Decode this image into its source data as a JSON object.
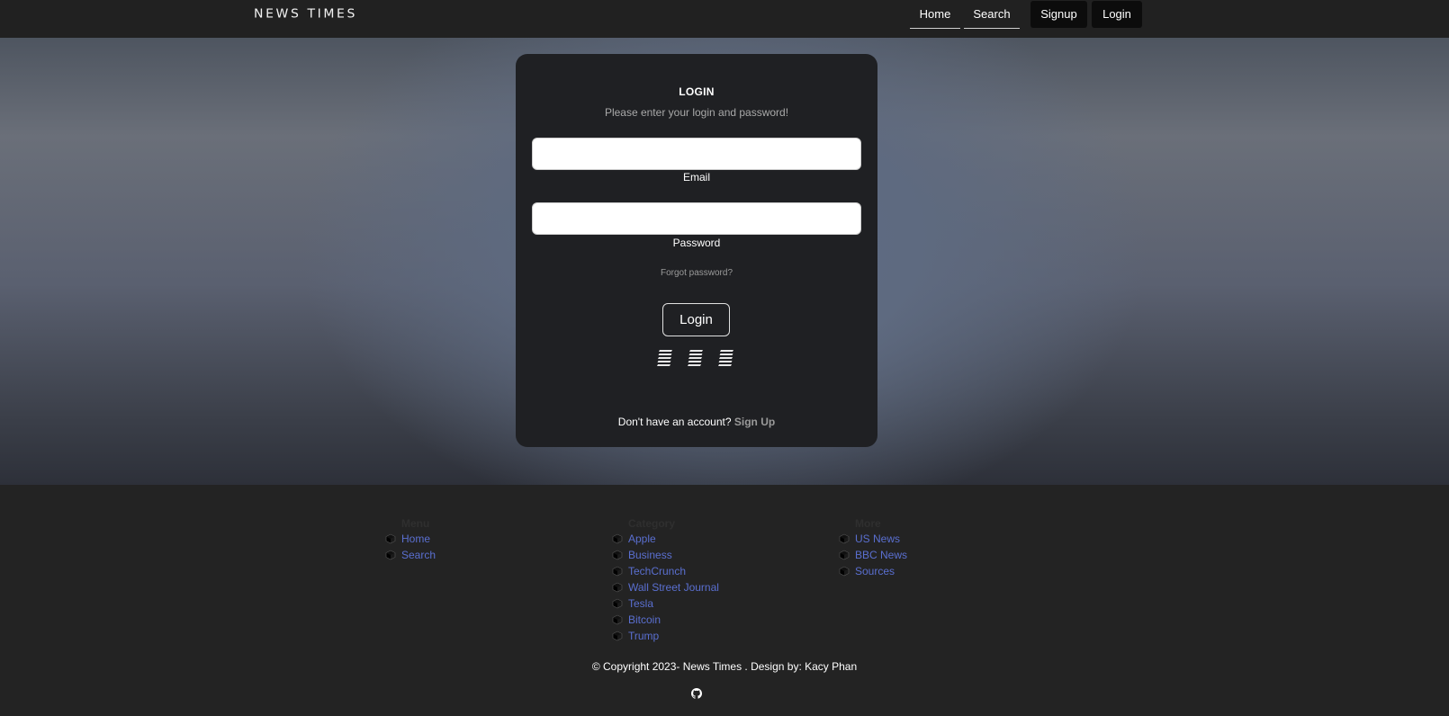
{
  "nav": {
    "brand": "NEWS TIMES",
    "links": [
      "Home",
      "Search"
    ],
    "signup_label": "Signup",
    "login_label": "Login"
  },
  "login_card": {
    "title": "LOGIN",
    "subtitle": "Please enter your login and password!",
    "email_label": "Email",
    "email_value": "",
    "password_label": "Password",
    "password_value": "",
    "forgot_label": "Forgot password?",
    "submit_label": "Login",
    "social_icons": [
      "social-icon-1",
      "social-icon-2",
      "social-icon-3"
    ],
    "no_account_text": "Don't have an account?",
    "signup_link": "Sign Up"
  },
  "footer": {
    "menu": {
      "heading": "Menu",
      "items": [
        "Home",
        "Search"
      ]
    },
    "category": {
      "heading": "Category",
      "items": [
        "Apple",
        "Business",
        "TechCrunch",
        "Wall Street Journal",
        "Tesla",
        "Bitcoin",
        "Trump"
      ]
    },
    "more": {
      "heading": "More",
      "items": [
        "US News",
        "BBC News",
        "Sources"
      ]
    },
    "copyright": "© Copyright 2023- News Times . Design by: Kacy Phan",
    "icons": [
      "cube-icon",
      "github-icon"
    ]
  },
  "colors": {
    "navbar": "#212121",
    "card": "#1f2023",
    "link": "#5a6fd0",
    "footer": "#232323"
  }
}
